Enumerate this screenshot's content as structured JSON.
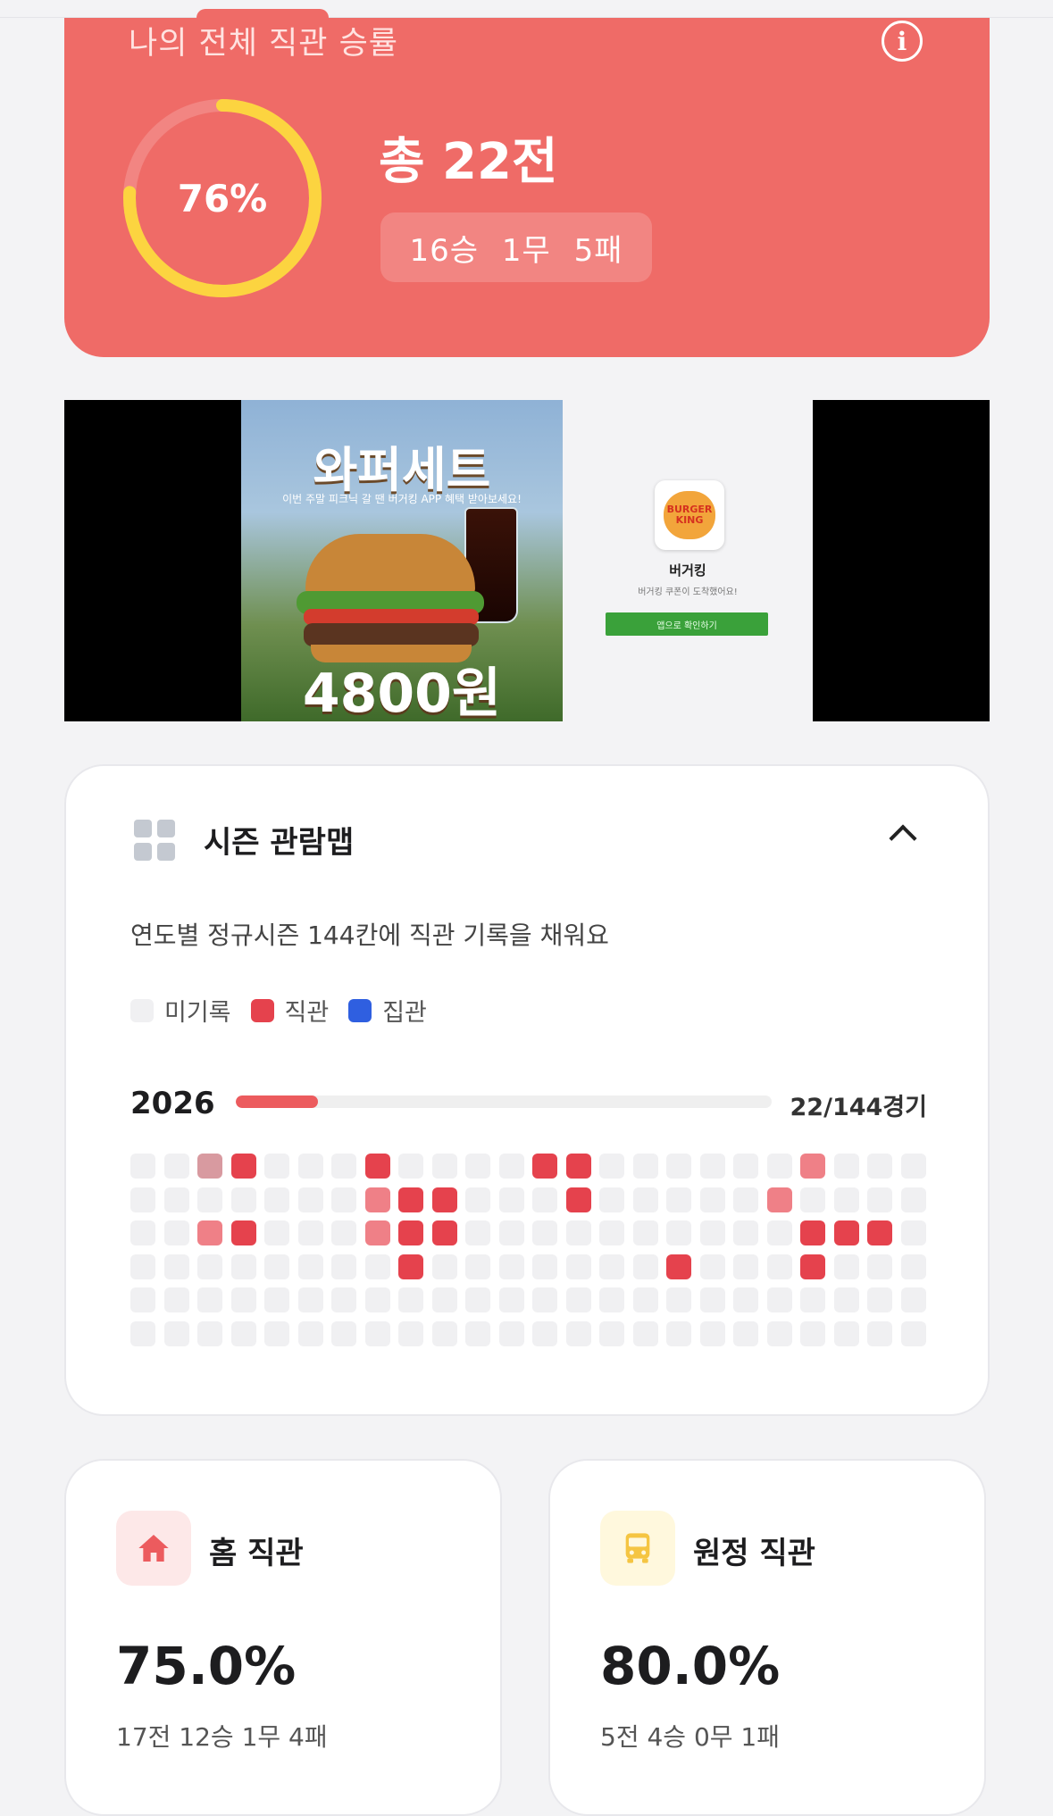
{
  "winrate": {
    "title": "나의 전체 직관 승률",
    "percent_label": "76%",
    "percent_value": 76,
    "total": "총 22전",
    "record": "16승 1무 5패",
    "ring_color": "#fcd440",
    "card_color": "#ef6b67"
  },
  "ad": {
    "headline": "와퍼세트",
    "subtext": "이번 주말 피크닉 갈 땐 버거킹 APP 혜택 받아보세요!",
    "price": "4800원",
    "brand_logo_text": "BURGER KING",
    "brand_name": "버거킹",
    "brand_desc": "버거킹 쿠폰이 도착했어요!",
    "button_label": "앱으로 확인하기"
  },
  "season_map": {
    "title": "시즌 관람맵",
    "description": "연도별 정규시즌 144칸에 직관 기록을 채워요",
    "legend": [
      {
        "label": "미기록",
        "color": "#f0f0f2"
      },
      {
        "label": "직관",
        "color": "#e5424d"
      },
      {
        "label": "집관",
        "color": "#2f5fe0"
      }
    ],
    "year": "2026",
    "progress_text": "22/144경기",
    "progress_fraction": 0.153,
    "grid_columns": 24,
    "grid_rows": 6,
    "cells": [
      {
        "row": 0,
        "col": 2,
        "shade": "faded"
      },
      {
        "row": 0,
        "col": 3,
        "shade": "solid"
      },
      {
        "row": 0,
        "col": 7,
        "shade": "solid"
      },
      {
        "row": 0,
        "col": 12,
        "shade": "solid"
      },
      {
        "row": 0,
        "col": 13,
        "shade": "solid"
      },
      {
        "row": 0,
        "col": 20,
        "shade": "light"
      },
      {
        "row": 1,
        "col": 7,
        "shade": "light"
      },
      {
        "row": 1,
        "col": 8,
        "shade": "solid"
      },
      {
        "row": 1,
        "col": 9,
        "shade": "solid"
      },
      {
        "row": 1,
        "col": 13,
        "shade": "solid"
      },
      {
        "row": 1,
        "col": 19,
        "shade": "light"
      },
      {
        "row": 2,
        "col": 2,
        "shade": "light"
      },
      {
        "row": 2,
        "col": 3,
        "shade": "solid"
      },
      {
        "row": 2,
        "col": 7,
        "shade": "light"
      },
      {
        "row": 2,
        "col": 8,
        "shade": "solid"
      },
      {
        "row": 2,
        "col": 9,
        "shade": "solid"
      },
      {
        "row": 2,
        "col": 20,
        "shade": "solid"
      },
      {
        "row": 2,
        "col": 21,
        "shade": "solid"
      },
      {
        "row": 2,
        "col": 22,
        "shade": "solid"
      },
      {
        "row": 3,
        "col": 8,
        "shade": "solid"
      },
      {
        "row": 3,
        "col": 16,
        "shade": "solid"
      },
      {
        "row": 3,
        "col": 20,
        "shade": "solid"
      }
    ],
    "shade_colors": {
      "solid": "#e5424d",
      "light": "#ef8087",
      "faded": "#d89aa0",
      "empty": "#f0f0f2"
    }
  },
  "home": {
    "title": "홈 직관",
    "percent": "75.0%",
    "detail": "17전 12승 1무 4패",
    "icon": "home-icon",
    "icon_bg": "#fde8e8",
    "icon_color": "#ec5b5e"
  },
  "away": {
    "title": "원정 직관",
    "percent": "80.0%",
    "detail": "5전 4승 0무 1패",
    "icon": "bus-icon",
    "icon_bg": "#fff8dd",
    "icon_color": "#f5c542"
  }
}
